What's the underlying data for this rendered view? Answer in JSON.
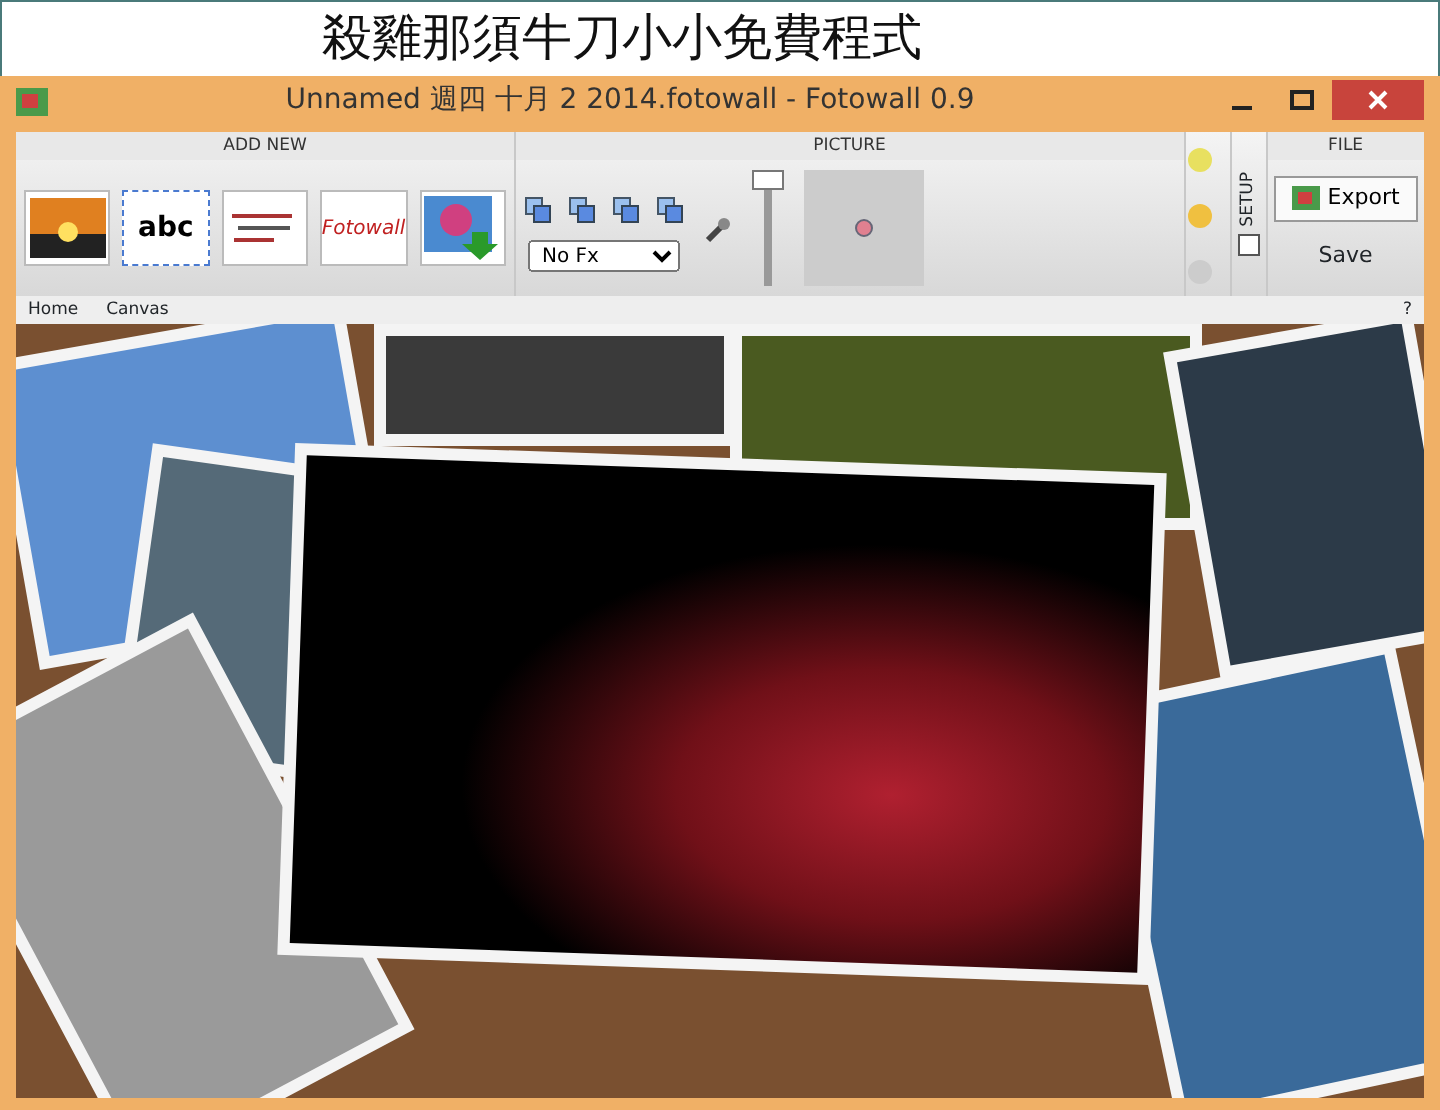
{
  "banner": {
    "title": "殺雞那須牛刀小小免費程式"
  },
  "window": {
    "title": "Unnamed 週四 十月 2 2014.fotowall - Fotowall 0.9"
  },
  "ribbon": {
    "groups": [
      {
        "kind": "add",
        "header": "ADD NEW",
        "tools": [
          {
            "kind": "picture"
          },
          {
            "kind": "text",
            "label": "abc"
          },
          {
            "kind": "wordcloud"
          },
          {
            "kind": "webcam",
            "label": "Fotowall"
          },
          {
            "kind": "download"
          }
        ]
      },
      {
        "kind": "picture",
        "header": "PICTURE",
        "effect": "No Fx",
        "slider": {
          "level": 1
        }
      },
      {
        "kind": "setup",
        "label": "SETUP",
        "checked": false
      },
      {
        "kind": "file",
        "header": "FILE",
        "buttons": [
          "Export",
          "Save"
        ]
      }
    ]
  },
  "breadcrumb": {
    "items": [
      "Home",
      "Canvas"
    ],
    "help": "?"
  }
}
